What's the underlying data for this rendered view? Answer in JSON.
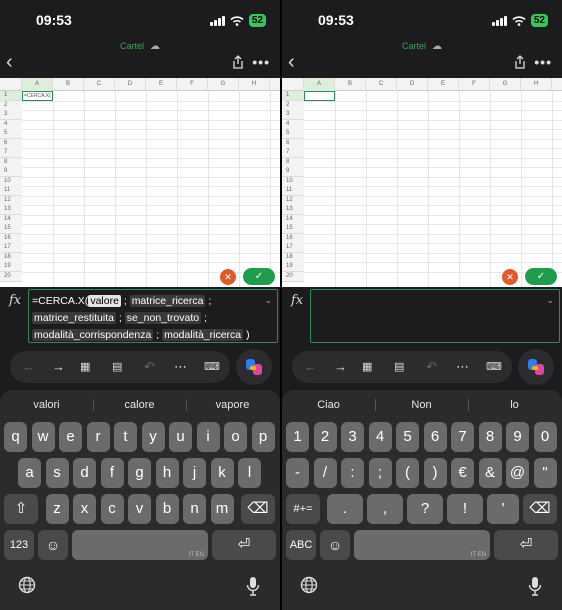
{
  "status": {
    "time": "09:53",
    "battery": "52"
  },
  "app": {
    "title": "Cartel"
  },
  "sheet": {
    "columns": [
      "A",
      "B",
      "C",
      "D",
      "E",
      "F",
      "G",
      "H"
    ],
    "rows": [
      "1",
      "2",
      "3",
      "4",
      "5",
      "6",
      "7",
      "8",
      "9",
      "10",
      "11",
      "12",
      "13",
      "14",
      "15",
      "16",
      "17",
      "18",
      "19",
      "20"
    ],
    "left_cell_content": "=CERCA.X("
  },
  "formula": {
    "prefix": "=CERCA.X(",
    "current_arg": "valore",
    "args": [
      "matrice_ricerca",
      "matrice_restituita",
      "se_non_trovato",
      "modalità_corrispondenza",
      "modalità_ricerca"
    ],
    "separator": ";",
    "close": ")"
  },
  "right_formula": {
    "text": ""
  },
  "left_keyboard": {
    "suggestions": [
      "valori",
      "calore",
      "vapore"
    ],
    "row1": [
      "q",
      "w",
      "e",
      "r",
      "t",
      "y",
      "u",
      "i",
      "o",
      "p"
    ],
    "row2": [
      "a",
      "s",
      "d",
      "f",
      "g",
      "h",
      "j",
      "k",
      "l"
    ],
    "row3": [
      "z",
      "x",
      "c",
      "v",
      "b",
      "n",
      "m"
    ],
    "mode_key": "123",
    "lang_label": "IT EN"
  },
  "right_keyboard": {
    "suggestions": [
      "Ciao",
      "Non",
      "lo"
    ],
    "row1": [
      "1",
      "2",
      "3",
      "4",
      "5",
      "6",
      "7",
      "8",
      "9",
      "0"
    ],
    "row2": [
      "-",
      "/",
      ":",
      ";",
      "(",
      ")",
      "€",
      "&",
      "@",
      "\""
    ],
    "row3": [
      ".",
      ",",
      "?",
      "!",
      "'"
    ],
    "sym_key": "#+=",
    "mode_key": "ABC",
    "lang_label": "IT EN"
  },
  "colors": {
    "accent": "#2e8b57",
    "confirm": "#1e9e4a",
    "cancel": "#e05a2b"
  }
}
